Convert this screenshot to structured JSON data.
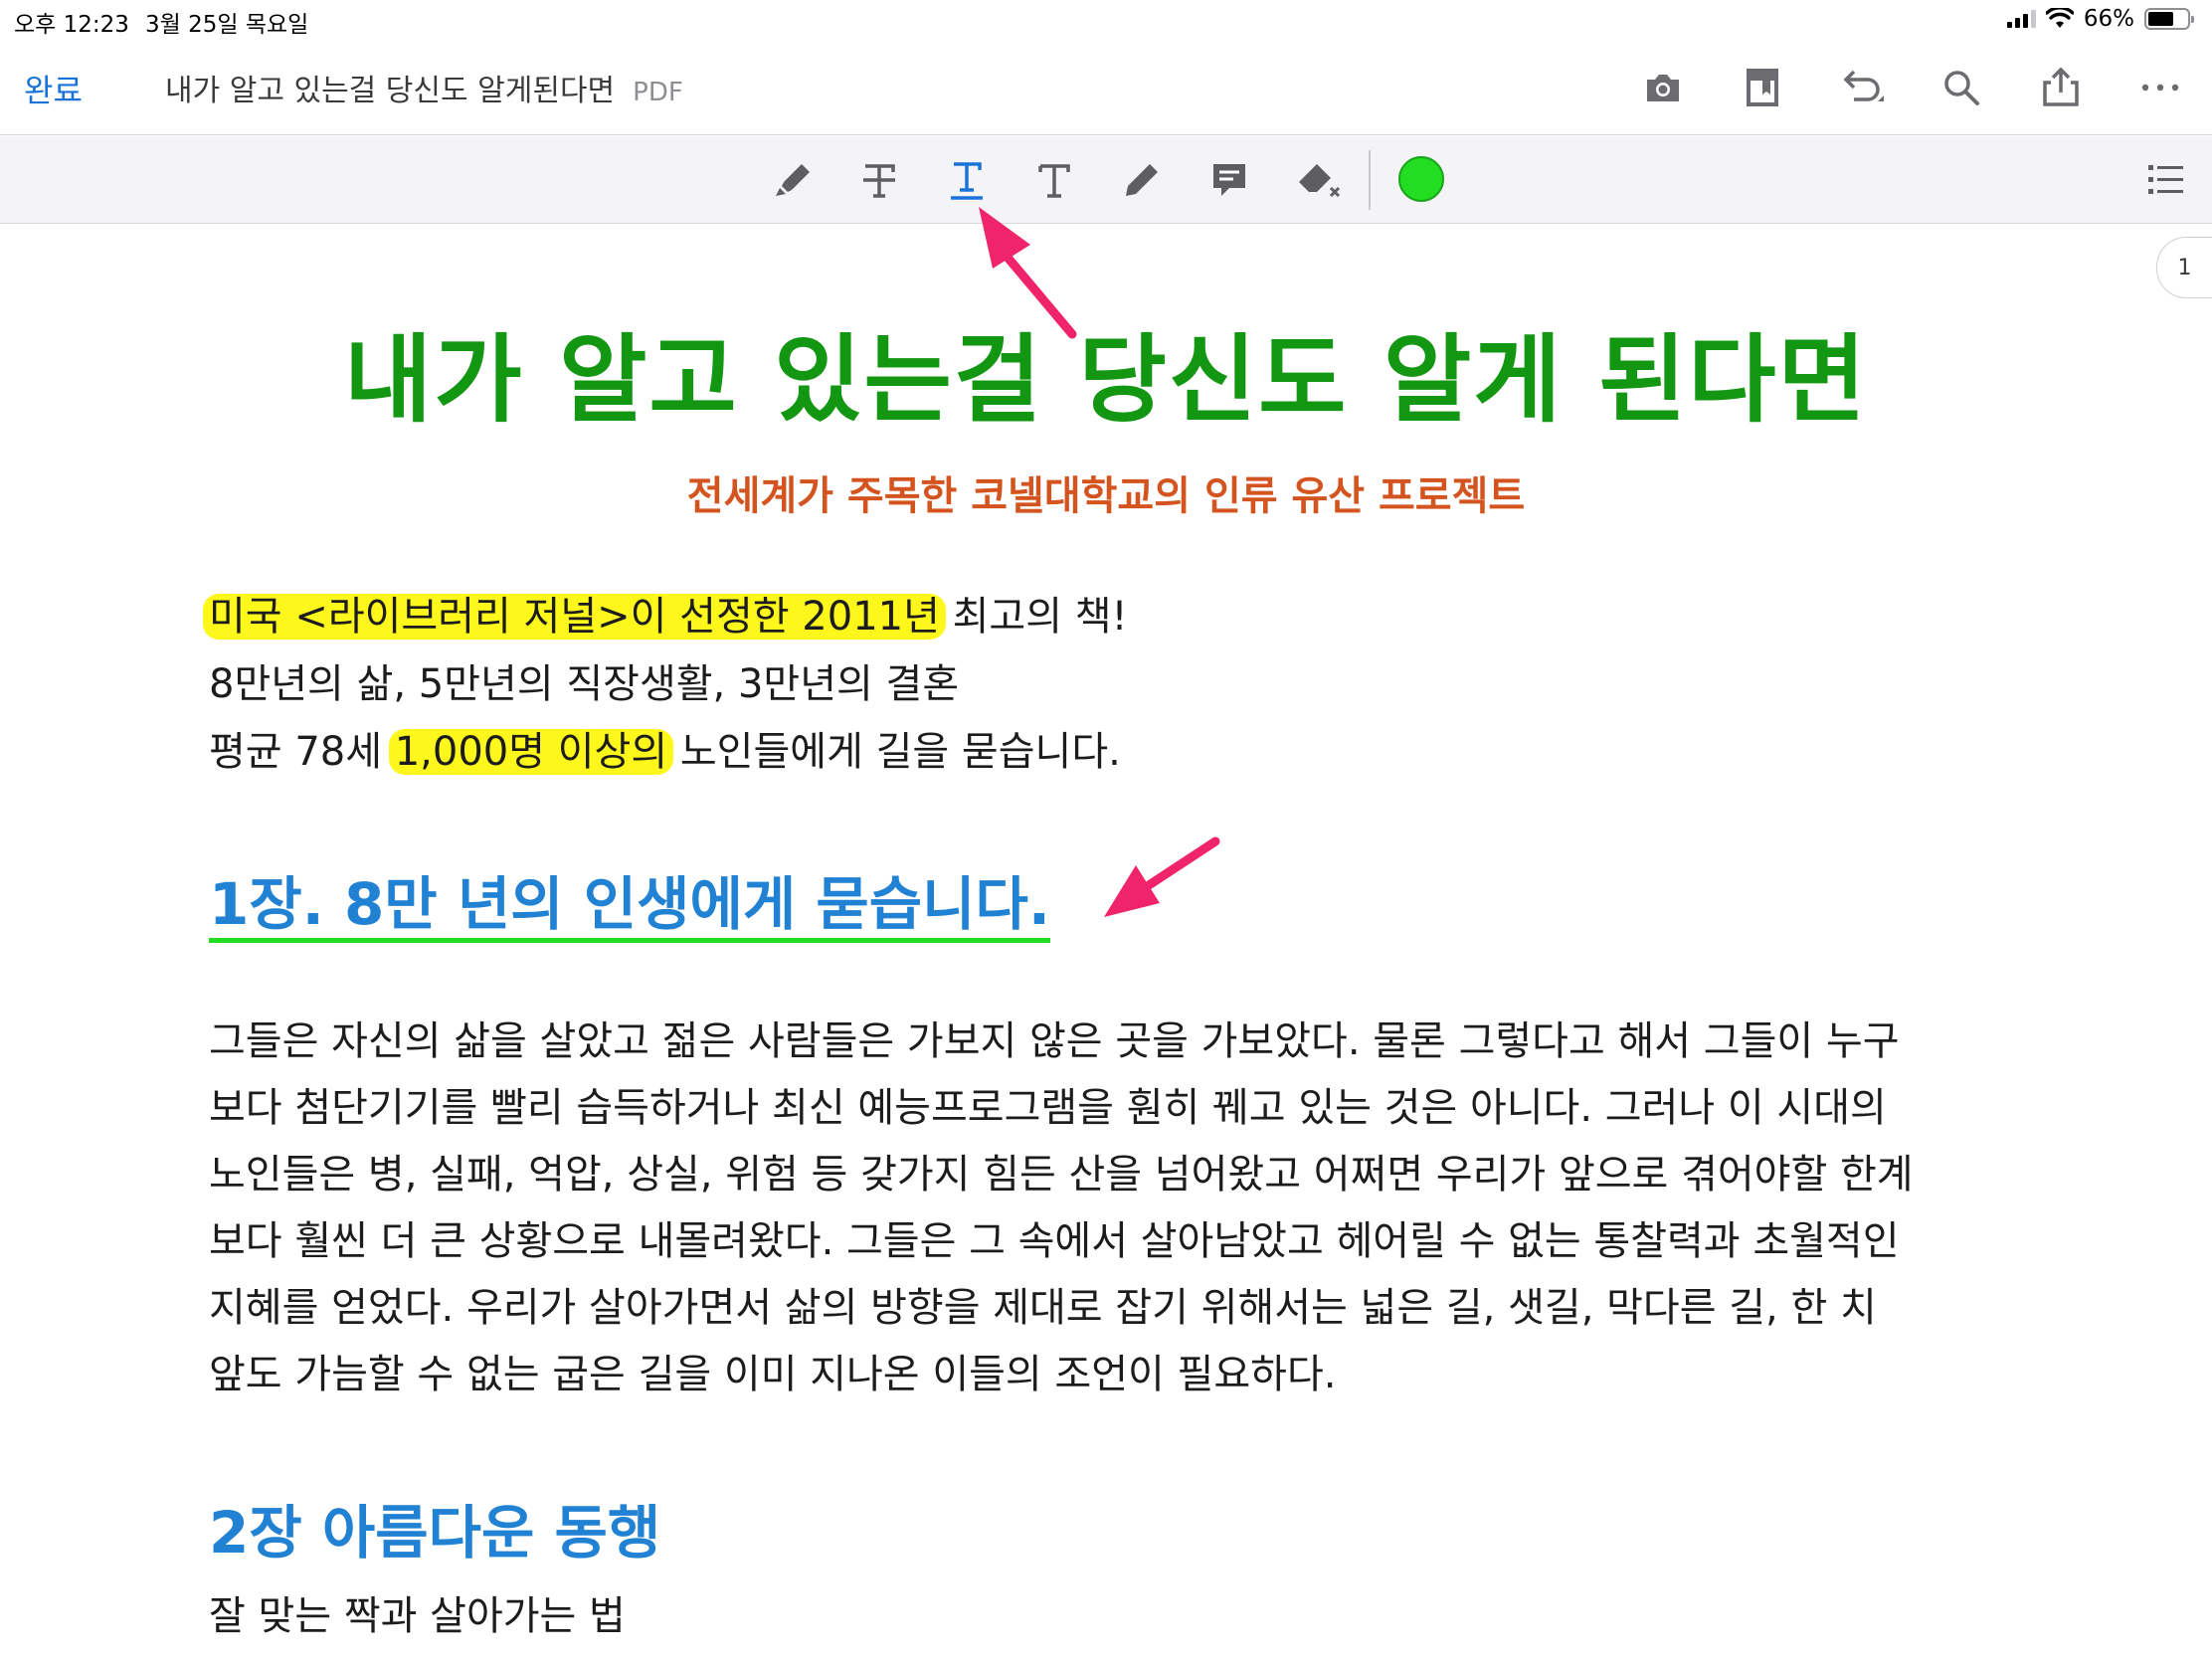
{
  "status_bar": {
    "time": "오후 12:23",
    "date": "3월 25일 목요일",
    "battery": "66%",
    "battery_level": 0.66
  },
  "nav": {
    "done_label": "완료",
    "doc_title": "내가 알고 있는걸 당신도 알게된다면",
    "doc_type": "PDF",
    "icons": [
      "camera-icon",
      "bookmark-icon",
      "undo-icon",
      "search-icon",
      "share-icon",
      "more-icon"
    ]
  },
  "toolbar": {
    "tools": [
      "highlighter-tool",
      "strikethrough-tool",
      "underline-tool",
      "text-tool",
      "pencil-tool",
      "comment-tool",
      "eraser-tool"
    ],
    "selected_tool": "underline-tool",
    "color": "#22dd22"
  },
  "page_index": "1",
  "document": {
    "title": "내가 알고 있는걸 당신도 알게 된다면",
    "subtitle": "전세계가 주목한 코넬대학교의 인류 유산 프로젝트",
    "intro": {
      "line1_highlight": "미국 <라이브러리 저널>이 선정한 2011년",
      "line1_rest": " 최고의 책!",
      "line2": "8만년의 삶, 5만년의 직장생활, 3만년의 결혼",
      "line3_before": "평균 78세 ",
      "line3_highlight": "1,000명 이상의",
      "line3_after": " 노인들에게 길을 묻습니다."
    },
    "chapter1": "1장. 8만 년의 인생에게 묻습니다.",
    "paragraph": [
      "그들은 자신의 삶을 살았고 젊은 사람들은 가보지 않은 곳을 가보았다. 물론 그렇다고 해서 그들이 누구",
      "보다 첨단기기를 빨리 습득하거나 최신 예능프로그램을 훤히 꿰고 있는 것은 아니다. 그러나 이 시대의",
      "노인들은 병, 실패, 억압, 상실, 위험 등 갖가지 힘든 산을 넘어왔고 어쩌면 우리가 앞으로 겪어야할 한계",
      "보다 훨씬 더 큰 상황으로 내몰려왔다. 그들은 그 속에서 살아남았고 헤어릴 수 없는 통찰력과 초월적인",
      "지혜를 얻었다. 우리가 살아가면서 삶의 방향을 제대로 잡기 위해서는 넓은 길, 샛길, 막다른 길, 한 치",
      "앞도 가늠할 수 없는 굽은 길을 이미 지나온 이들의 조언이 필요하다."
    ],
    "chapter2": "2장 아름다운 동행",
    "chapter2_sub": "잘 맞는 짝과 살아가는 법"
  },
  "colors": {
    "accent_blue": "#1a73d9",
    "title_green": "#139713",
    "subtitle_orange": "#d4541f",
    "chapter_blue": "#2181d2",
    "highlight_yellow": "#fdf71c",
    "underline_green": "#22dd22",
    "arrow_pink": "#f0246a"
  }
}
